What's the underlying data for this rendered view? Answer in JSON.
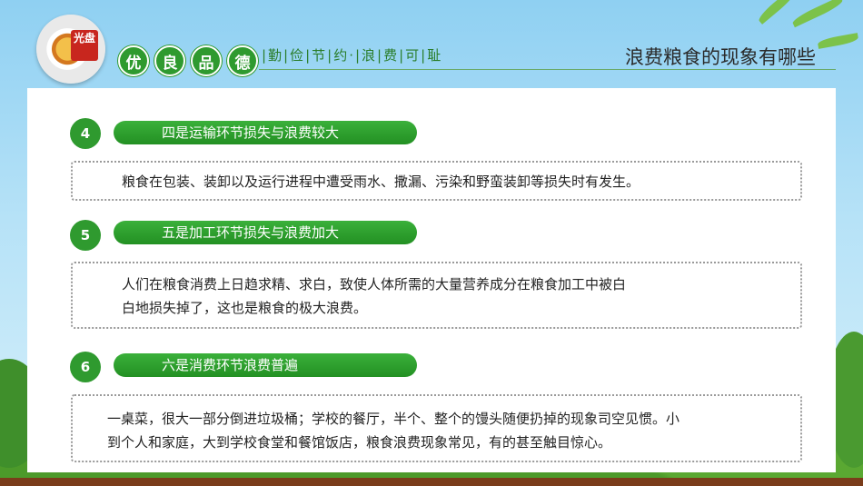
{
  "header": {
    "logo_text": "光盘",
    "badges": [
      "优",
      "良",
      "品",
      "德"
    ],
    "subtitle": "|勤|俭|节|约·|浪|费|可|耻",
    "title": "浪费粮食的现象有哪些"
  },
  "items": [
    {
      "number": "4",
      "heading": "四是运输环节损失与浪费较大",
      "lines": [
        "粮食在包装、装卸以及运行进程中遭受雨水、撒漏、污染和野蛮装卸等损失时有发生。"
      ]
    },
    {
      "number": "5",
      "heading": "五是加工环节损失与浪费加大",
      "lines": [
        "人们在粮食消费上日趋求精、求白，致使人体所需的大量营养成分在粮食加工中被白",
        "白地损失掉了，这也是粮食的极大浪费。"
      ]
    },
    {
      "number": "6",
      "heading": "六是消费环节浪费普遍",
      "lines": [
        "一桌菜，很大一部分倒进垃圾桶；学校的餐厅，半个、整个的馒头随便扔掉的现象司空见惯。小",
        "到个人和家庭，大到学校食堂和餐馆饭店，粮食浪费现象常见，有的甚至触目惊心。"
      ]
    }
  ]
}
